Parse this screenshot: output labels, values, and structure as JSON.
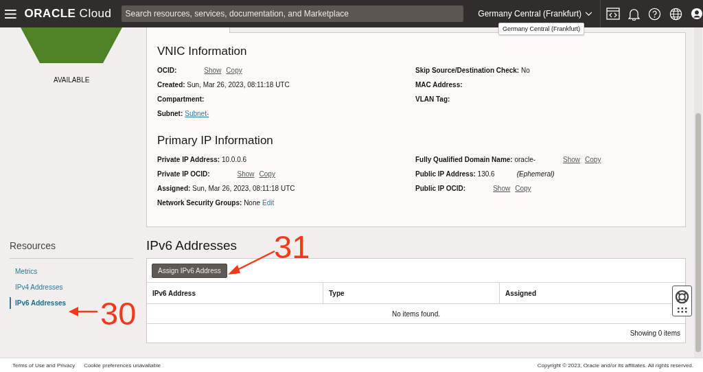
{
  "header": {
    "brand": "ORACLE",
    "product": "Cloud",
    "search": {
      "placeholder": "Search resources, services, documentation, and Marketplace"
    },
    "region": "Germany Central (Frankfurt)",
    "tooltip": "Germany Central (Frankfurt)"
  },
  "status": {
    "label": "AVAILABLE"
  },
  "vnic_information": {
    "title": "VNIC Information",
    "left": [
      {
        "label": "OCID:",
        "actions": [
          "Show",
          "Copy"
        ]
      },
      {
        "label": "Created:",
        "value": "Sun, Mar 26, 2023, 08:11:18 UTC"
      },
      {
        "label": "Compartment:"
      },
      {
        "label": "Subnet:",
        "link": "Subnet-"
      }
    ],
    "right": [
      {
        "label": "Skip Source/Destination Check:",
        "value": "No"
      },
      {
        "label": "MAC Address:"
      },
      {
        "label": "VLAN Tag:"
      }
    ]
  },
  "primary_ip_information": {
    "title": "Primary IP Information",
    "left": [
      {
        "label": "Private IP Address:",
        "value": "10.0.0.6"
      },
      {
        "label": "Private IP OCID:",
        "actions": [
          "Show",
          "Copy"
        ]
      },
      {
        "label": "Assigned:",
        "value": "Sun, Mar 26, 2023, 08:11:18 UTC"
      },
      {
        "label": "Network Security Groups:",
        "value": "None",
        "edit": "Edit"
      }
    ],
    "right": [
      {
        "label": "Fully Qualified Domain Name:",
        "value": "oracle-",
        "actions": [
          "Show",
          "Copy"
        ]
      },
      {
        "label": "Public IP Address:",
        "value": "130.6",
        "note": "(Ephemeral)"
      },
      {
        "label": "Public IP OCID:",
        "actions": [
          "Show",
          "Copy"
        ]
      }
    ]
  },
  "resources": {
    "title": "Resources",
    "items": [
      {
        "label": "Metrics",
        "selected": false
      },
      {
        "label": "IPv4 Addresses",
        "selected": false
      },
      {
        "label": "IPv6 Addresses",
        "selected": true
      }
    ]
  },
  "ipv6": {
    "title": "IPv6 Addresses",
    "button": "Assign IPv6 Address",
    "columns": [
      "IPv6 Address",
      "Type",
      "Assigned"
    ],
    "empty": "No items found.",
    "count": "Showing 0 items"
  },
  "annotations": [
    {
      "number": "31"
    },
    {
      "number": "30"
    }
  ],
  "footer": {
    "links": [
      "Terms of Use and Privacy",
      "Cookie preferences unavailable"
    ],
    "copyright": "Copyright © 2023, Oracle and/or its affiliates. All rights reserved."
  }
}
